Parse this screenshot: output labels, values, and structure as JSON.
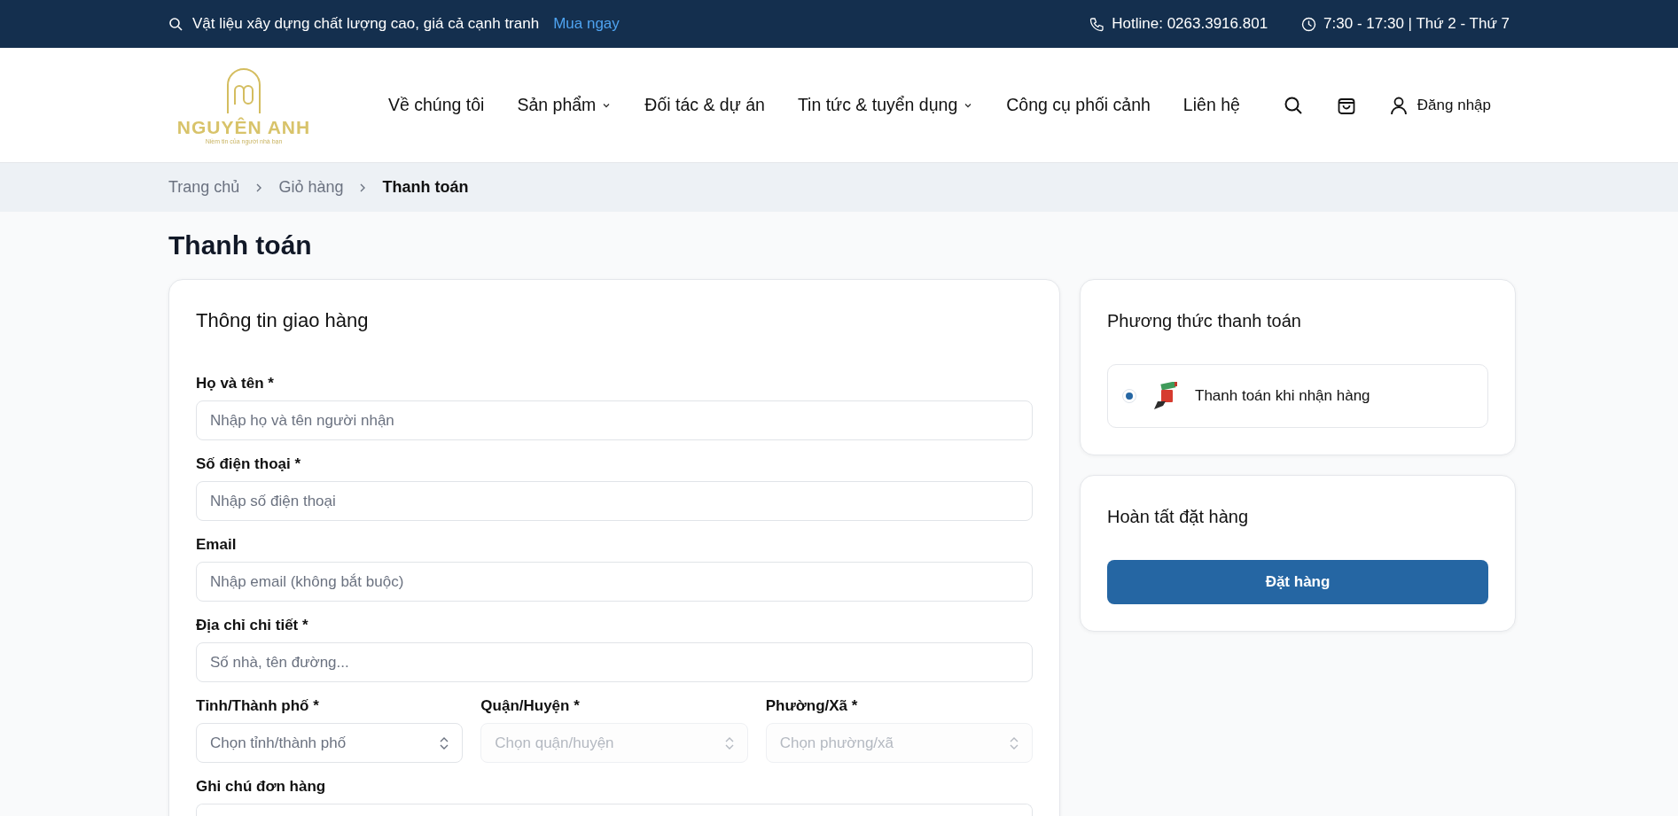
{
  "top_bar": {
    "promo": "Vật liệu xây dựng chất lượng cao, giá cả cạnh tranh",
    "promo_link": "Mua ngay",
    "hotline": "Hotline: 0263.3916.801",
    "hours": "7:30 - 17:30 | Thứ 2 - Thứ 7"
  },
  "header": {
    "logo": {
      "name": "NGUYÊN ANH",
      "tagline": "Niềm tin của người nhà bạn"
    },
    "nav": [
      {
        "label": "Về chúng tôi",
        "dropdown": false
      },
      {
        "label": "Sản phẩm",
        "dropdown": true
      },
      {
        "label": "Đối tác & dự án",
        "dropdown": false
      },
      {
        "label": "Tin tức & tuyển dụng",
        "dropdown": true
      },
      {
        "label": "Công cụ phối cảnh",
        "dropdown": false
      },
      {
        "label": "Liên hệ",
        "dropdown": false
      }
    ],
    "login": "Đăng nhập"
  },
  "breadcrumb": [
    {
      "label": "Trang chủ",
      "current": false
    },
    {
      "label": "Giỏ hàng",
      "current": false
    },
    {
      "label": "Thanh toán",
      "current": true
    }
  ],
  "page_title": "Thanh toán",
  "shipping": {
    "title": "Thông tin giao hàng",
    "fields": [
      {
        "kind": "text",
        "label": "Họ và tên *",
        "placeholder": "Nhập họ và tên người nhận"
      },
      {
        "kind": "text",
        "label": "Số điện thoại *",
        "placeholder": "Nhập số điện thoại"
      },
      {
        "kind": "text",
        "label": "Email",
        "placeholder": "Nhập email (không bắt buộc)"
      },
      {
        "kind": "text",
        "label": "Địa chỉ chi tiết *",
        "placeholder": "Số nhà, tên đường..."
      },
      {
        "kind": "row",
        "fields": [
          {
            "label": "Tỉnh/Thành phố *",
            "placeholder": "Chọn tỉnh/thành phố",
            "disabled": false
          },
          {
            "label": "Quận/Huyện *",
            "placeholder": "Chọn quận/huyện",
            "disabled": true
          },
          {
            "label": "Phường/Xã *",
            "placeholder": "Chọn phường/xã",
            "disabled": true
          }
        ]
      },
      {
        "kind": "textarea",
        "label": "Ghi chú đơn hàng"
      }
    ]
  },
  "payment": {
    "title": "Phương thức thanh toán",
    "options": [
      {
        "label": "Thanh toán khi nhận hàng",
        "selected": true
      }
    ]
  },
  "complete": {
    "title": "Hoàn tất đặt hàng",
    "button": "Đặt hàng"
  }
}
